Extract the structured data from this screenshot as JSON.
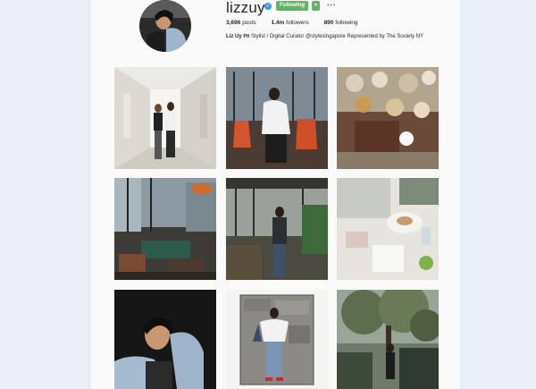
{
  "profile": {
    "username": "lizzuy",
    "follow_button": "Following",
    "dropdown_symbol": "▾",
    "more_symbol": "•••",
    "verified_symbol": "✓",
    "stats": {
      "posts_value": "3,696",
      "posts_label": "posts",
      "followers_value": "1.4m",
      "followers_label": "followers",
      "following_value": "890",
      "following_label": "following"
    },
    "bio_name": "Liz Uy",
    "bio_flag": "PH",
    "bio_text": "Stylist / Digital Curator @stylesingapore Represented by The Society NY"
  },
  "colors": {
    "follow_green": "#5cb85c",
    "verified_blue": "#3897f0",
    "outer_background": "#e9eef7"
  },
  "posts": [
    {
      "subject": "two women in hallway"
    },
    {
      "subject": "woman seated orange chairs"
    },
    {
      "subject": "tea set on table"
    },
    {
      "subject": "lounge interior with lamps"
    },
    {
      "subject": "woman in restaurant"
    },
    {
      "subject": "dessert table flatlay"
    },
    {
      "subject": "woman portrait denim jacket"
    },
    {
      "subject": "woman off-shoulder top stone wall"
    },
    {
      "subject": "woman in garden tree"
    }
  ]
}
